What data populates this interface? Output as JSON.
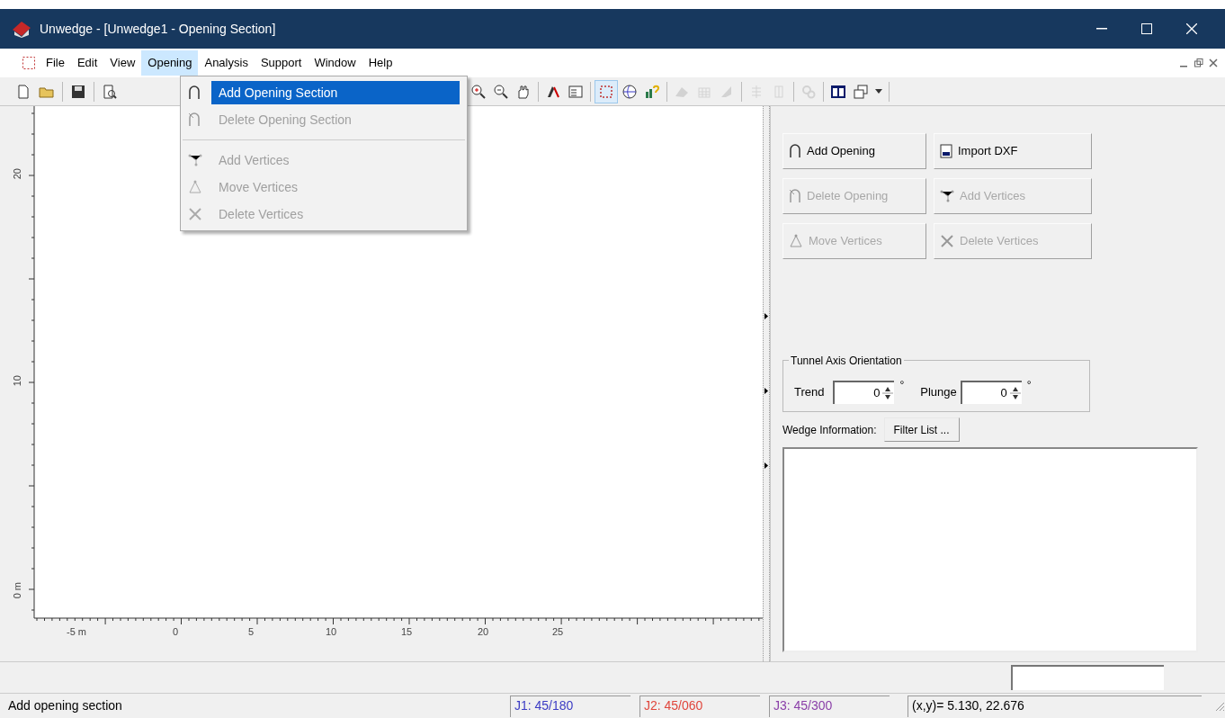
{
  "window": {
    "title": "Unwedge - [Unwedge1 - Opening Section]"
  },
  "menu_bar": [
    {
      "label": "File",
      "selected": false
    },
    {
      "label": "Edit",
      "selected": false
    },
    {
      "label": "View",
      "selected": false
    },
    {
      "label": "Opening",
      "selected": true
    },
    {
      "label": "Analysis",
      "selected": false
    },
    {
      "label": "Support",
      "selected": false
    },
    {
      "label": "Window",
      "selected": false
    },
    {
      "label": "Help",
      "selected": false
    }
  ],
  "opening_menu": [
    {
      "kind": "item",
      "label": "Add Opening Section",
      "selected": true,
      "disabled": false
    },
    {
      "kind": "item",
      "label": "Delete Opening Section",
      "selected": false,
      "disabled": true
    },
    {
      "kind": "separator"
    },
    {
      "kind": "item",
      "label": "Add Vertices",
      "selected": false,
      "disabled": true
    },
    {
      "kind": "item",
      "label": "Move Vertices",
      "selected": false,
      "disabled": true
    },
    {
      "kind": "item",
      "label": "Delete Vertices",
      "selected": false,
      "disabled": true
    }
  ],
  "toolbar_left": [
    {
      "kind": "tool",
      "disabled": false
    },
    {
      "kind": "dropdown",
      "disabled": false
    },
    {
      "kind": "separator"
    },
    {
      "kind": "tool",
      "disabled": false
    },
    {
      "kind": "separator"
    },
    {
      "kind": "tool",
      "disabled": false
    }
  ],
  "toolbar_right": [
    {
      "kind": "tool",
      "disabled": false,
      "selected": false
    },
    {
      "kind": "tool",
      "disabled": false,
      "selected": false
    },
    {
      "kind": "tool",
      "disabled": false,
      "selected": false
    },
    {
      "kind": "separator"
    },
    {
      "kind": "tool",
      "disabled": false,
      "selected": false
    },
    {
      "kind": "tool",
      "disabled": false,
      "selected": false
    },
    {
      "kind": "separator"
    },
    {
      "kind": "tool",
      "disabled": false,
      "selected": true
    },
    {
      "kind": "tool",
      "disabled": false,
      "selected": false
    },
    {
      "kind": "tool",
      "disabled": false,
      "selected": false
    },
    {
      "kind": "separator"
    },
    {
      "kind": "tool",
      "disabled": true,
      "selected": false
    },
    {
      "kind": "tool",
      "disabled": true,
      "selected": false
    },
    {
      "kind": "tool",
      "disabled": true,
      "selected": false
    },
    {
      "kind": "separator"
    },
    {
      "kind": "tool",
      "disabled": true,
      "selected": false
    },
    {
      "kind": "tool",
      "disabled": true,
      "selected": false
    },
    {
      "kind": "separator"
    },
    {
      "kind": "tool",
      "disabled": true,
      "selected": false
    },
    {
      "kind": "separator"
    },
    {
      "kind": "tool",
      "disabled": false,
      "selected": false
    },
    {
      "kind": "tool",
      "disabled": false,
      "selected": false
    },
    {
      "kind": "dropdown",
      "disabled": false,
      "selected": false
    },
    {
      "kind": "separator"
    }
  ],
  "canvas": {
    "x_labels": [
      "-5 m",
      "0",
      "5",
      "10",
      "15",
      "20",
      "25"
    ],
    "y_labels": [
      "20",
      "10",
      "0 m"
    ]
  },
  "panel": {
    "buttons": [
      {
        "label": "Add Opening",
        "disabled": false
      },
      {
        "label": "Import DXF",
        "disabled": false
      },
      {
        "label": "Delete Opening",
        "disabled": true
      },
      {
        "label": "Add Vertices",
        "disabled": true
      },
      {
        "label": "Move Vertices",
        "disabled": true
      },
      {
        "label": "Delete Vertices",
        "disabled": true
      }
    ],
    "orientation": {
      "title": "Tunnel Axis Orientation",
      "fields": [
        {
          "label": "Trend",
          "value": "0",
          "unit": "°"
        },
        {
          "label": "Plunge",
          "value": "0",
          "unit": "°"
        }
      ]
    },
    "wedge_information": {
      "label": "Wedge Information:",
      "button": "Filter List ..."
    }
  },
  "status_bar": {
    "message": "Add opening section",
    "joints": [
      {
        "text": "J1: 45/180",
        "color": "#3b3bc4"
      },
      {
        "text": "J2: 45/060",
        "color": "#e0463c"
      },
      {
        "text": "J3: 45/300",
        "color": "#8a3fa8"
      }
    ],
    "coordinates": "(x,y)= 5.130, 22.676"
  }
}
